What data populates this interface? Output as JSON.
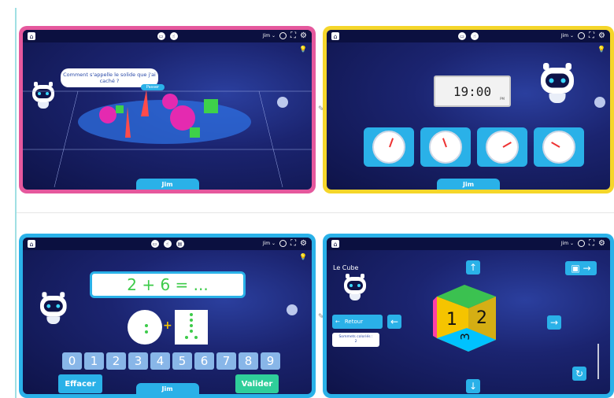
{
  "screens": {
    "solids": {
      "top": {
        "user": "Jim ⌄"
      },
      "question": "Comment s'appelle le solide que j'ai caché ?",
      "passer_label": "Passer",
      "jim_label": "Jim"
    },
    "clock": {
      "top": {
        "user": "Jim ⌄"
      },
      "time_display": "19:00",
      "time_suffix": "PM",
      "jim_label": "Jim"
    },
    "addition": {
      "top": {
        "user": "Jim ⌄"
      },
      "equation": "2 + 6 = ...",
      "plus": "+",
      "digits": [
        "0",
        "1",
        "2",
        "3",
        "4",
        "5",
        "6",
        "7",
        "8",
        "9"
      ],
      "erase_label": "Effacer",
      "validate_label": "Valider",
      "jim_label": "Jim"
    },
    "cube": {
      "top": {
        "user": "Jim ⌄"
      },
      "title": "Le Cube",
      "back_label": "Retour",
      "info_line1": "Sommets coloriés :",
      "info_line2": "2",
      "face_digits": [
        "1",
        "2",
        "3"
      ]
    }
  },
  "colors": {
    "pink_frame": "#e5589d",
    "yellow_frame": "#f5d62a",
    "blue_frame": "#2ab1e8",
    "screen_dark": "#0e1348",
    "green_text": "#3dcb4a",
    "validate": "#2fce9a"
  },
  "icons": {
    "home": "home-icon",
    "settings": "gear-icon",
    "fullscreen": "fullscreen-icon",
    "reload": "reload-icon",
    "hint": "lightbulb-icon"
  }
}
